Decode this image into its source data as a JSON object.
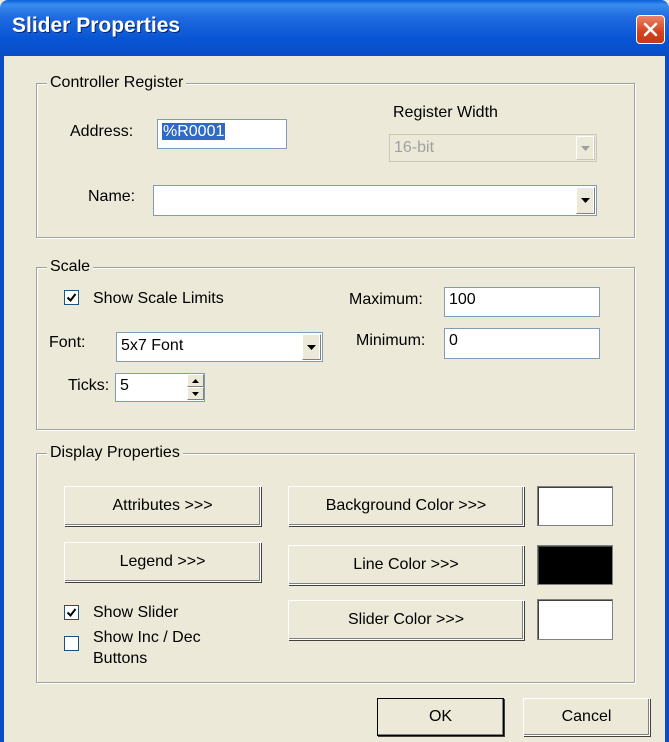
{
  "window": {
    "title": "Slider Properties"
  },
  "controller_register": {
    "group_label": "Controller Register",
    "address_label": "Address:",
    "address_value": "%R0001",
    "register_width_label": "Register Width",
    "register_width_value": "16-bit",
    "name_label": "Name:",
    "name_value": ""
  },
  "scale": {
    "group_label": "Scale",
    "show_scale_limits_label": "Show Scale Limits",
    "show_scale_limits_checked": true,
    "maximum_label": "Maximum:",
    "maximum_value": "100",
    "font_label": "Font:",
    "font_value": "5x7 Font",
    "minimum_label": "Minimum:",
    "minimum_value": "0",
    "ticks_label": "Ticks:",
    "ticks_value": "5"
  },
  "display_properties": {
    "group_label": "Display Properties",
    "attributes_button": "Attributes >>>",
    "legend_button": "Legend >>>",
    "background_color_button": "Background Color >>>",
    "line_color_button": "Line Color >>>",
    "slider_color_button": "Slider Color >>>",
    "background_color": "#ffffff",
    "line_color": "#000000",
    "slider_color": "#ffffff",
    "show_slider_label": "Show Slider",
    "show_slider_checked": true,
    "show_inc_dec_label_line1": "Show Inc / Dec",
    "show_inc_dec_label_line2": "Buttons",
    "show_inc_dec_checked": false
  },
  "footer": {
    "ok_label": "OK",
    "cancel_label": "Cancel"
  }
}
